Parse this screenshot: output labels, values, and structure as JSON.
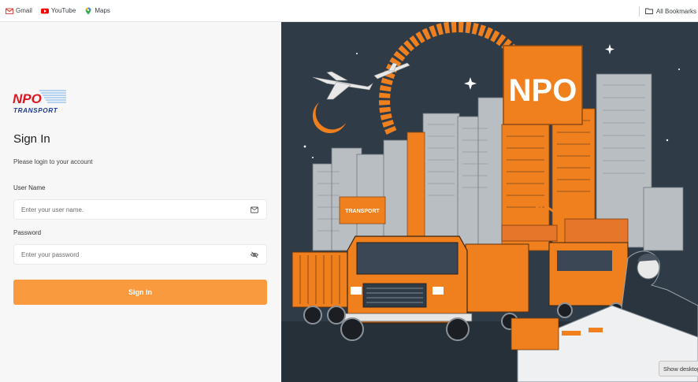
{
  "bookmarks": {
    "items": [
      {
        "label": "Gmail",
        "icon": "gmail-icon"
      },
      {
        "label": "YouTube",
        "icon": "youtube-icon"
      },
      {
        "label": "Maps",
        "icon": "maps-icon"
      }
    ],
    "all_label": "All Bookmarks"
  },
  "login": {
    "logo_text_top": "NPO",
    "logo_text_bottom": "TRANSPORT",
    "title": "Sign In",
    "subtitle": "Please login to your account",
    "username_label": "User Name",
    "username_placeholder": "Enter your user name.",
    "password_label": "Password",
    "password_placeholder": "Enter your password",
    "submit_label": "Sign In"
  },
  "hero": {
    "billboard_text": "NPO",
    "sign_text": "TRANSPORT"
  },
  "overlay": {
    "show_desktop_label": "Show desktop"
  },
  "colors": {
    "accent": "#f99a3e",
    "logo_red": "#e0141e",
    "logo_blue": "#1a3c8f",
    "hero_bg": "#2f3c47",
    "hero_orange": "#f07f1e"
  }
}
